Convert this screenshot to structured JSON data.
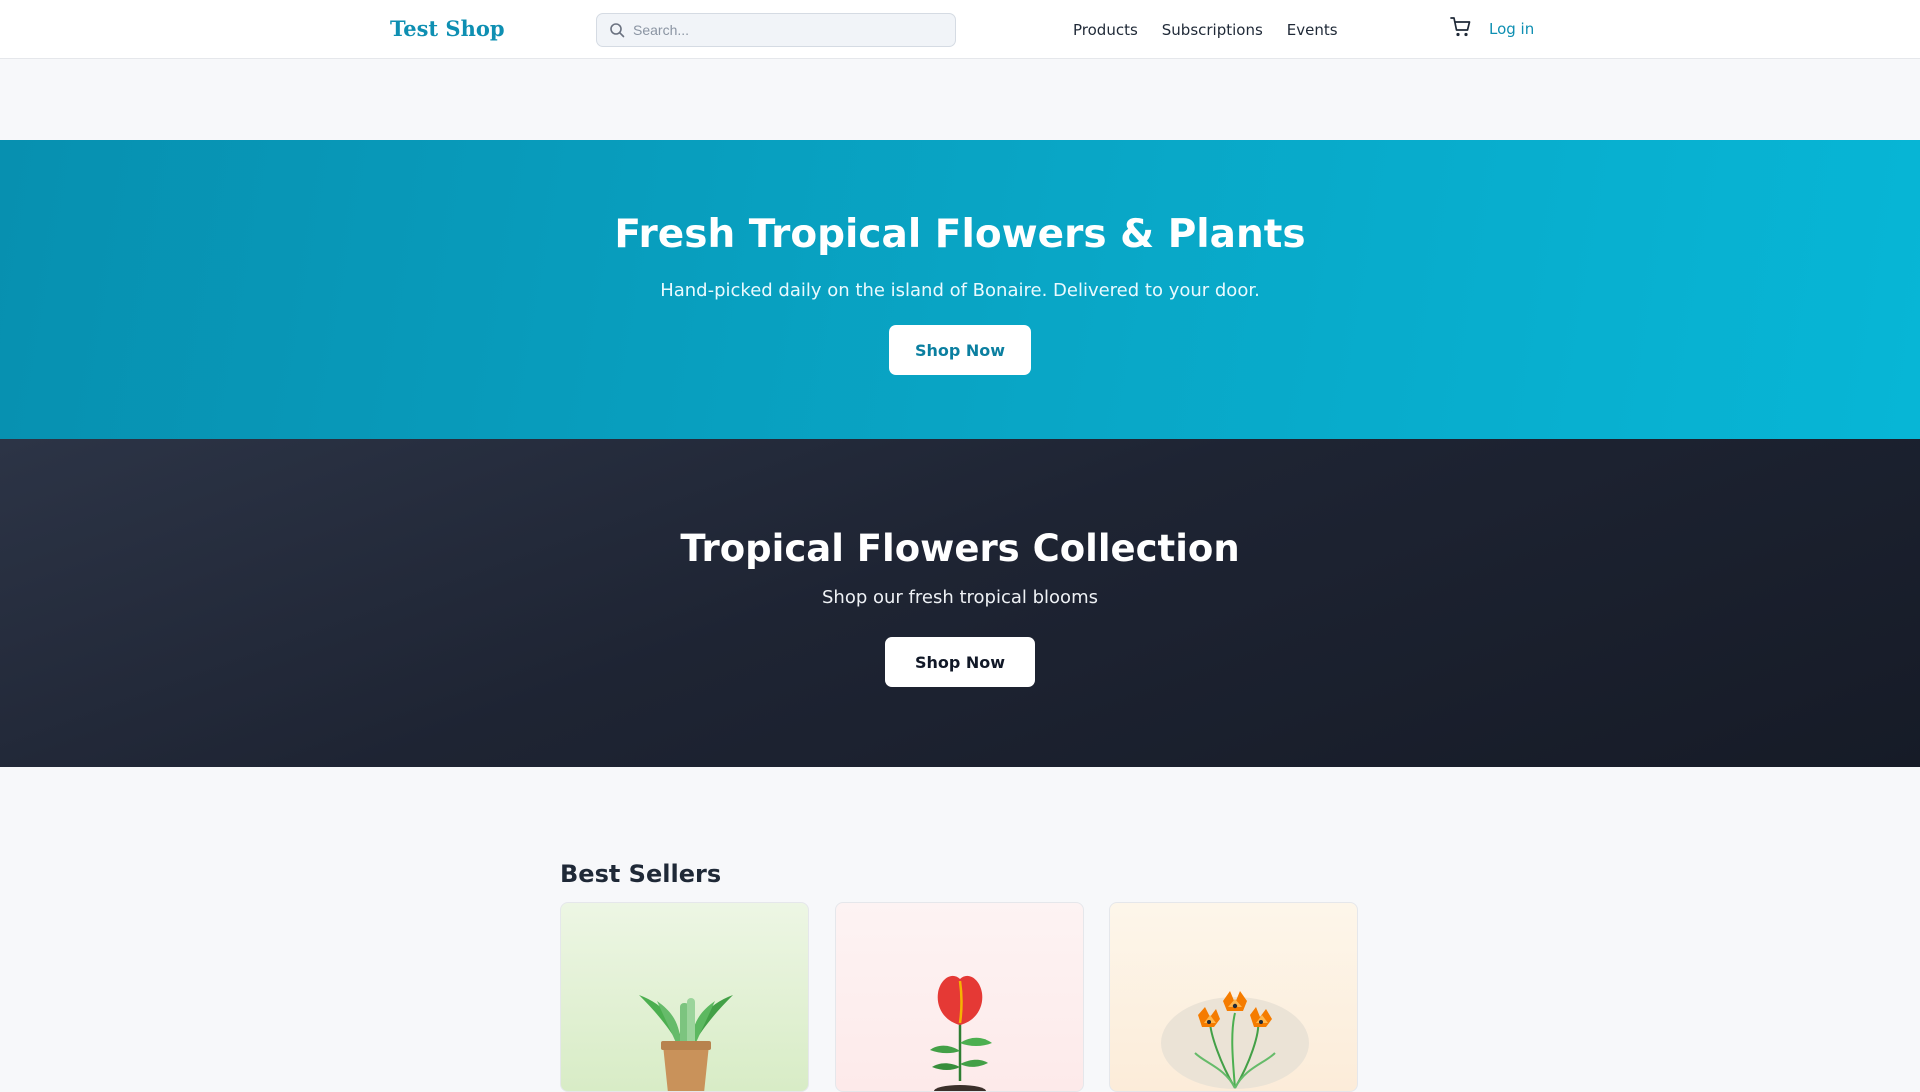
{
  "header": {
    "logo": "Test Shop",
    "search_placeholder": "Search...",
    "nav": [
      "Products",
      "Subscriptions",
      "Events"
    ],
    "login": "Log in"
  },
  "hero": {
    "title": "Fresh Tropical Flowers & Plants",
    "subtitle": "Hand-picked daily on the island of Bonaire. Delivered to your door.",
    "button": "Shop Now"
  },
  "collection": {
    "title": "Tropical Flowers Collection",
    "subtitle": "Shop our fresh tropical blooms",
    "button": "Shop Now"
  },
  "best_sellers": {
    "title": "Best Sellers"
  },
  "colors": {
    "brand": "#0e8fb2",
    "hero_start": "#0790b0",
    "hero_end": "#07b6d6",
    "dark_band": "#1e2433"
  }
}
